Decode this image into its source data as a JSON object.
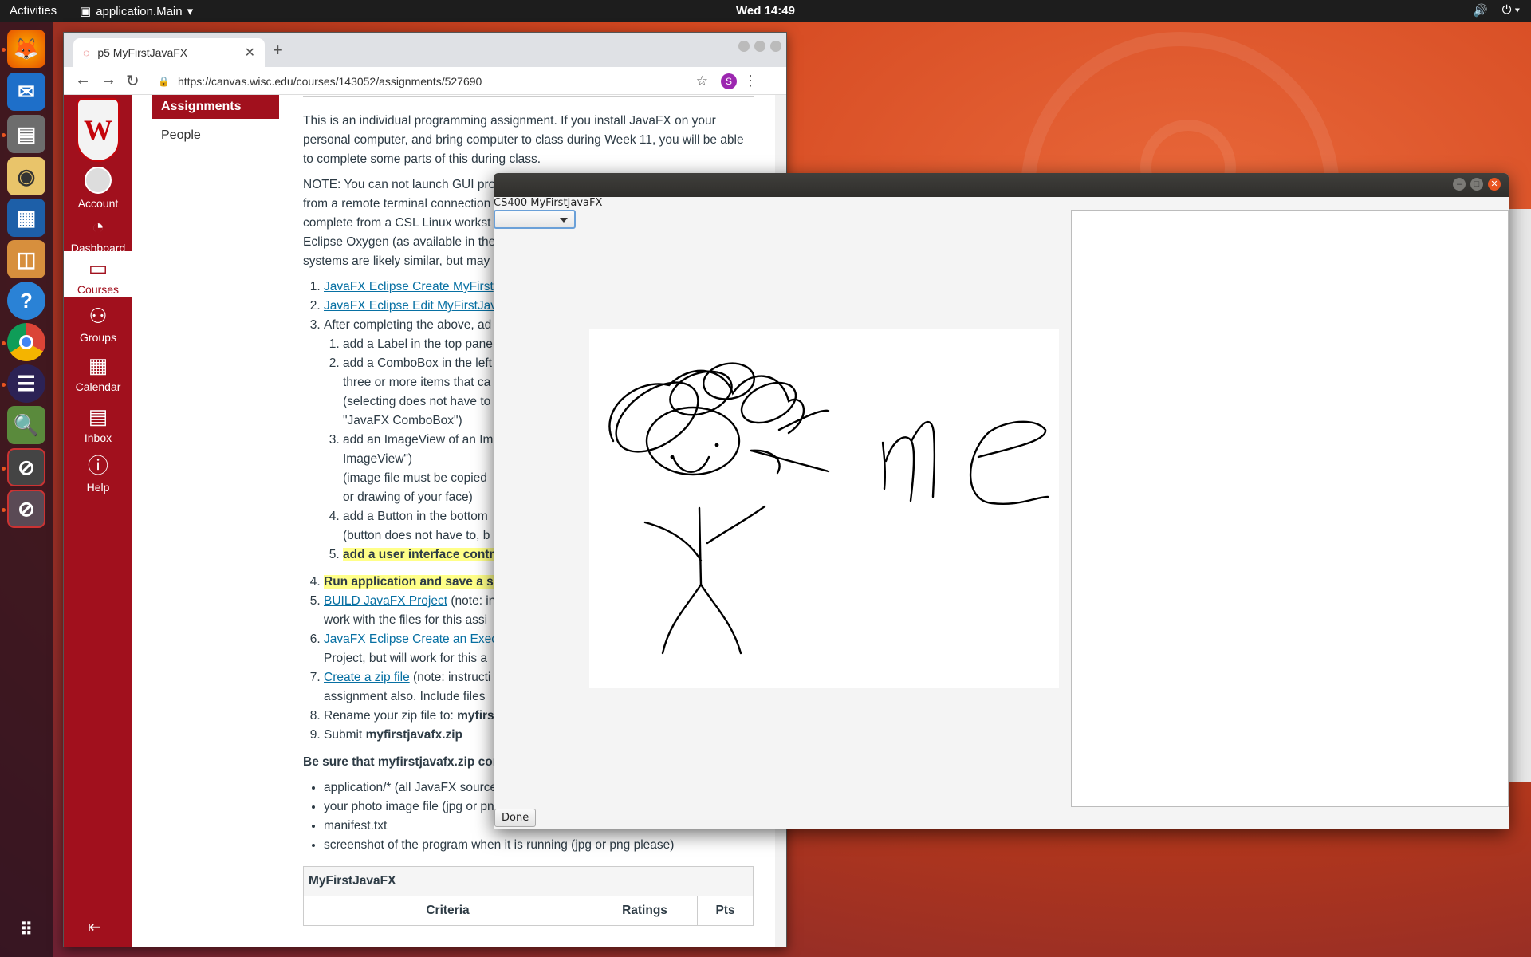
{
  "top_panel": {
    "activities": "Activities",
    "app_menu": "application.Main",
    "clock": "Wed 14:49"
  },
  "dock": {
    "items": [
      "firefox-icon",
      "thunderbird-icon",
      "files-icon",
      "rhythmbox-icon",
      "libreoffice-writer-icon",
      "software-center-icon",
      "help-icon",
      "chrome-icon",
      "eclipse-icon",
      "image-viewer-icon",
      "app-window-icon",
      "app-window-icon",
      "show-applications-icon"
    ]
  },
  "browser": {
    "tab_title": "p5 MyFirstJavaFX",
    "url": "https://canvas.wisc.edu/courses/143052/assignments/527690",
    "profile_initial": "S"
  },
  "canvas_nav": {
    "logo": "W",
    "items": [
      {
        "label": "Account"
      },
      {
        "label": "Dashboard"
      },
      {
        "label": "Courses"
      },
      {
        "label": "Groups"
      },
      {
        "label": "Calendar"
      },
      {
        "label": "Inbox"
      },
      {
        "label": "Help"
      }
    ]
  },
  "course_nav": {
    "items": [
      {
        "label": "Assignments"
      },
      {
        "label": "People"
      }
    ]
  },
  "assignment": {
    "intro": "This is an individual programming assignment. If you install JavaFX on your personal computer, and bring computer to class during Week 11, you will be able to complete some parts of this during class.",
    "note_lines": [
      "NOTE: You can not launch GUI pro",
      "from a remote terminal connection",
      "complete from a CSL Linux workst",
      "Eclipse Oxygen (as available in the",
      "systems are likely similar, but may"
    ],
    "step1_link": "JavaFX Eclipse Create MyFirst",
    "step2_link": "JavaFX Eclipse Edit MyFirstJav",
    "step3": "After completing the above, ad",
    "sub1": "add a Label in the top pane",
    "sub2_l1": "add a ComboBox in the left",
    "sub2_l2": "three or more items that ca",
    "sub2_l3": "(selecting does not have to",
    "sub2_l4": "\"JavaFX ComboBox\")",
    "sub3_l1": "add an ImageView of an Im",
    "sub3_l2": "ImageView\")",
    "sub3_l3": "(image file must be copied",
    "sub3_l4": "or drawing of your face)",
    "sub4_l1": "add a Button in the bottom",
    "sub4_l2": "(button does not have to, b",
    "sub5": "add a user interface contro",
    "step4": "Run application and save a scr",
    "step5_link": "BUILD JavaFX Project",
    "step5_rest": " (note: in",
    "step5_l2": "work with the files for this assi",
    "step6_link": "JavaFX Eclipse Create an Exec",
    "step6_l2": "Project, but will work for this a",
    "step7_link": "Create a zip file",
    "step7_rest": " (note: instructi",
    "step7_l2": "assignment also.  Include files",
    "step8_pre": "Rename your zip file to: ",
    "step8_bold": "myfirs",
    "step9_pre": "Submit ",
    "step9_bold": "myfirstjavafx.zip",
    "be_sure": "Be sure that myfirstjavafx.zip con",
    "bullets": [
      "application/* (all JavaFX source",
      "your photo image file (jpg or pn",
      "manifest.txt",
      "screenshot of the program when it is running (jpg or png please)"
    ],
    "rubric_title": "MyFirstJavaFX",
    "rubric_cols": [
      "Criteria",
      "Ratings",
      "Pts"
    ]
  },
  "fx_window": {
    "label": "CS400 MyFirstJavaFX",
    "combo_value": "",
    "done_button": "Done"
  }
}
